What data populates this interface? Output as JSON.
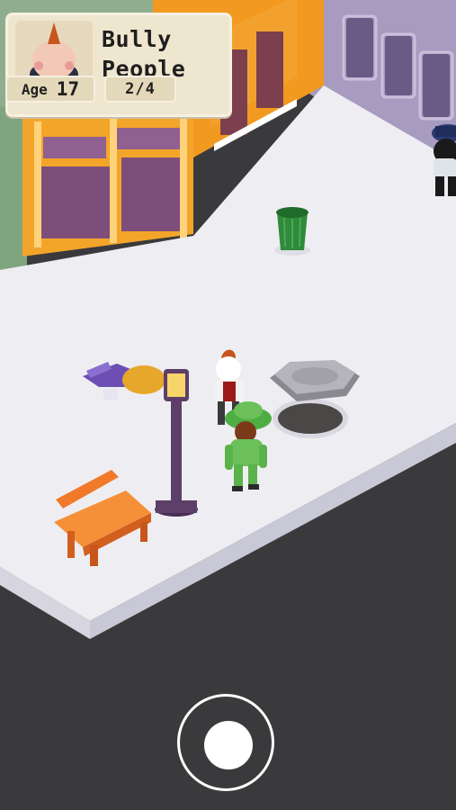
{
  "hud": {
    "mission": {
      "title_line1": "Bully",
      "title_line2": "People",
      "avatar_icon": "mohawk-bully-avatar-icon"
    },
    "age": {
      "label": "Age",
      "value": "17"
    },
    "progress": {
      "text": "2/4",
      "completed": 2,
      "total": 4
    }
  },
  "controls": {
    "joystick_icon": "virtual-joystick-icon"
  },
  "colors": {
    "sidewalk": "#eeeef2",
    "road": "#3a3a3c",
    "orange_building": "#f29a1f",
    "purple_building": "#8a7ea6",
    "hud_card": "#efe6d0",
    "trash_can": "#2f8a3a",
    "bench": "#f07a2a",
    "lamp_post": "#5e3f6a",
    "player_suit": "#6cc05a"
  }
}
